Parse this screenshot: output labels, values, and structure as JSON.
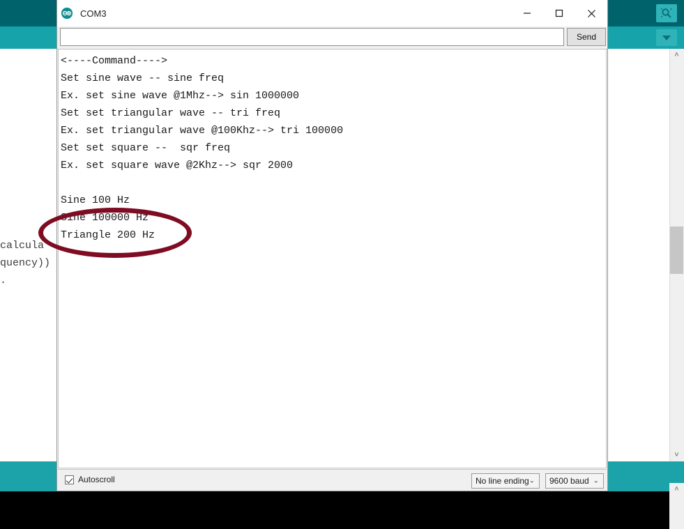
{
  "ide": {
    "monitor_icon": "magnifier-icon",
    "dropdown_icon": "chevron-down-icon",
    "editor_text": "calcula\nquency))\n.",
    "colors": {
      "teal_dark": "#00626b",
      "teal_light": "#16a3aa",
      "teal_bottom": "#1ba3a9",
      "button_teal": "#2fb3b8"
    }
  },
  "window": {
    "title": "COM3",
    "app_icon": "arduino-logo-icon",
    "minimize_label": "─",
    "maximize_label": "□",
    "close_label": "✕"
  },
  "send_bar": {
    "input_value": "",
    "input_placeholder": "",
    "send_label": "Send"
  },
  "console": {
    "lines": [
      "<----Command---->",
      "Set sine wave -- sine freq",
      "Ex. set sine wave @1Mhz--> sin 1000000",
      "Set set triangular wave -- tri freq",
      "Ex. set triangular wave @100Khz--> tri 100000",
      "Set set square --  sqr freq",
      "Ex. set square wave @2Khz--> sqr 2000",
      "",
      "Sine 100 Hz",
      "Sine 100000 Hz",
      "Triangle 200 Hz"
    ]
  },
  "status_bar": {
    "autoscroll_label": "Autoscroll",
    "autoscroll_checked": true,
    "line_ending_value": "No line ending",
    "baud_value": "9600 baud",
    "chevron": "⌄"
  },
  "annotation": {
    "shape": "ellipse",
    "color": "#7e0c22",
    "encircles": "Triangle 200 Hz"
  },
  "scrollbar": {
    "up_arrow": "˄",
    "down_arrow": "˅"
  }
}
